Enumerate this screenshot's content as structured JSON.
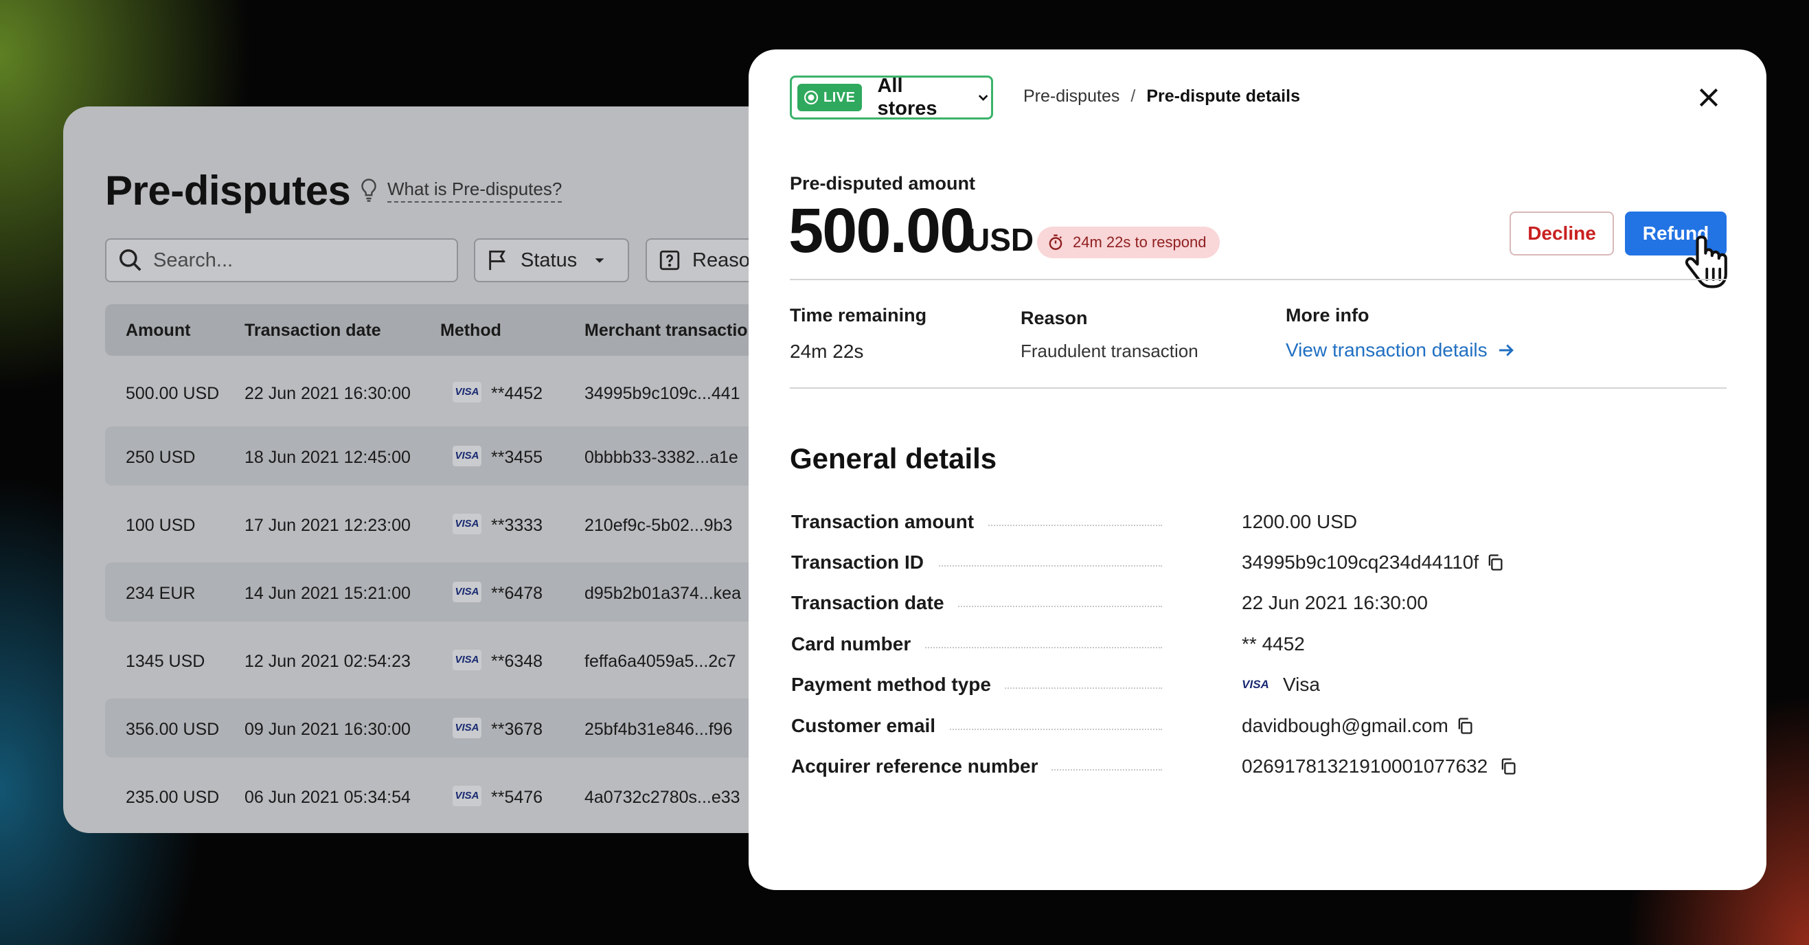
{
  "list": {
    "title": "Pre-disputes",
    "help_link": "What is Pre-disputes?",
    "search_placeholder": "Search...",
    "filters": {
      "status": "Status",
      "reason": "Reason"
    },
    "columns": [
      "Amount",
      "Transaction date",
      "Method",
      "Merchant transaction"
    ],
    "rows": [
      {
        "amount": "500.00 USD",
        "date": "22 Jun 2021 16:30:00",
        "card": "**4452",
        "merchant_tx": "34995b9c109c...441"
      },
      {
        "amount": "250 USD",
        "date": "18 Jun 2021 12:45:00",
        "card": "**3455",
        "merchant_tx": "0bbbb33-3382...a1e"
      },
      {
        "amount": "100 USD",
        "date": "17 Jun 2021 12:23:00",
        "card": "**3333",
        "merchant_tx": "210ef9c-5b02...9b3"
      },
      {
        "amount": "234 EUR",
        "date": "14 Jun 2021 15:21:00",
        "card": "**6478",
        "merchant_tx": "d95b2b01a374...kea"
      },
      {
        "amount": "1345 USD",
        "date": "12 Jun 2021 02:54:23",
        "card": "**6348",
        "merchant_tx": "feffa6a4059a5...2c7"
      },
      {
        "amount": "356.00 USD",
        "date": "09 Jun 2021 16:30:00",
        "card": "**3678",
        "merchant_tx": "25bf4b31e846...f96"
      },
      {
        "amount": "235.00 USD",
        "date": "06 Jun 2021 05:34:54",
        "card": "**5476",
        "merchant_tx": "4a0732c2780s...e33"
      }
    ],
    "card_brand": "VISA"
  },
  "modal": {
    "live_label": "LIVE",
    "store_selector": "All stores",
    "breadcrumb": {
      "parent": "Pre-disputes",
      "separator": "/",
      "current": "Pre-dispute details"
    },
    "amount_label": "Pre-disputed amount",
    "amount_value": "500.00",
    "amount_currency": "USD",
    "timer_text": "24m 22s to respond",
    "decline_label": "Decline",
    "refund_label": "Refund",
    "info": {
      "time_remaining_label": "Time remaining",
      "time_remaining_value": "24m 22s",
      "reason_label": "Reason",
      "reason_value": "Fraudulent transaction",
      "more_info_label": "More info",
      "more_info_link": "View transaction details"
    },
    "general_title": "General details",
    "details": [
      {
        "label": "Transaction amount",
        "value": "1200.00 USD"
      },
      {
        "label": "Transaction ID",
        "value": "34995b9c109cq234d44110f"
      },
      {
        "label": "Transaction date",
        "value": "22 Jun 2021 16:30:00"
      },
      {
        "label": "Card number",
        "value": "** 4452"
      },
      {
        "label": "Payment method type",
        "value": "Visa",
        "brand": "VISA"
      },
      {
        "label": "Customer email",
        "value": "davidbough@gmail.com"
      },
      {
        "label": "Acquirer reference number",
        "value": "02691781321910001077632"
      }
    ]
  },
  "colors": {
    "accent_blue": "#2273e3",
    "live_green": "#2fa95d",
    "decline_red": "#c92020",
    "timer_bg": "#f9d6d8",
    "link_blue": "#1f6fc2"
  },
  "icons": [
    "lightbulb-icon",
    "search-icon",
    "flag-icon",
    "question-box-icon",
    "chevron-down-icon",
    "live-dot-icon",
    "close-icon",
    "stopwatch-icon",
    "arrow-right-icon",
    "copy-icon",
    "hand-pointer-icon"
  ]
}
